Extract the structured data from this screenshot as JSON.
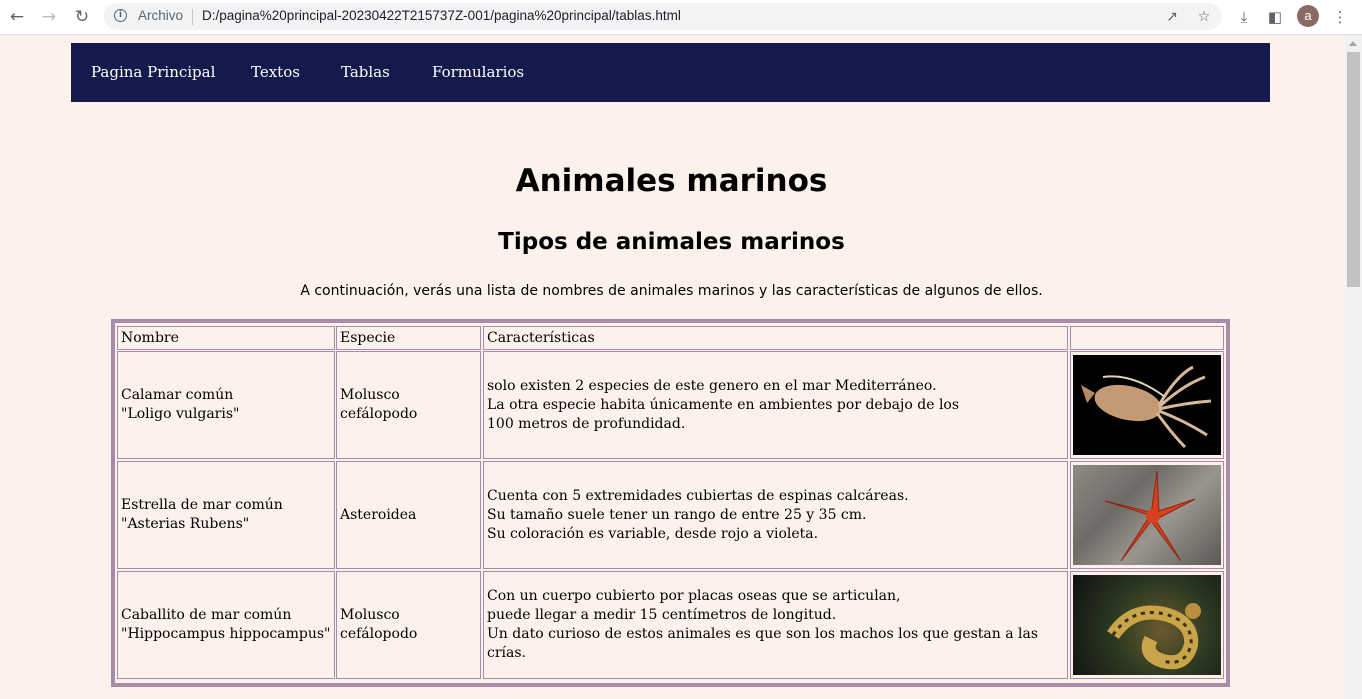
{
  "browser": {
    "scheme_label": "Archivo",
    "url": "D:/pagina%20principal-20230422T215737Z-001/pagina%20principal/tablas.html",
    "avatar_letter": "a"
  },
  "nav": {
    "items": [
      {
        "label": "Pagina Principal"
      },
      {
        "label": "Textos"
      },
      {
        "label": "Tablas"
      },
      {
        "label": "Formularios"
      }
    ]
  },
  "page": {
    "title": "Animales marinos",
    "subtitle": "Tipos de animales marinos",
    "intro": "A continuación, verás una lista de nombres de animales marinos y las características de algunos de ellos."
  },
  "table": {
    "headers": [
      "Nombre",
      "Especie",
      "Características",
      ""
    ],
    "rows": [
      {
        "nombre": "Calamar común\n\"Loligo vulgaris\"",
        "especie": "Molusco cefálopodo",
        "caracteristicas": "solo existen 2 especies de este genero en el mar Mediterráneo.\nLa otra especie habita únicamente en ambientes por debajo de los\n100 metros de profundidad.",
        "image": "squid-photo"
      },
      {
        "nombre": "Estrella de mar común\n\"Asterias Rubens\"",
        "especie": "Asteroidea",
        "caracteristicas": "Cuenta con 5 extremidades cubiertas de espinas calcáreas.\nSu tamaño suele tener un rango de entre 25 y 35 cm.\nSu coloración es variable, desde rojo a violeta.",
        "image": "starfish-photo"
      },
      {
        "nombre": "Caballito de mar común\n\"Hippocampus hippocampus\"",
        "especie": "Molusco cefálopodo",
        "caracteristicas": "Con un cuerpo cubierto por placas oseas que se articulan,\npuede llegar a medir 15 centímetros de longitud.\nUn dato curioso de estos animales es que son los machos los que gestan a las crías.",
        "image": "seahorse-photo"
      }
    ]
  },
  "colors": {
    "page_bg": "#fdf1ec",
    "nav_bg": "#141a4b",
    "table_border": "#a78bab"
  }
}
